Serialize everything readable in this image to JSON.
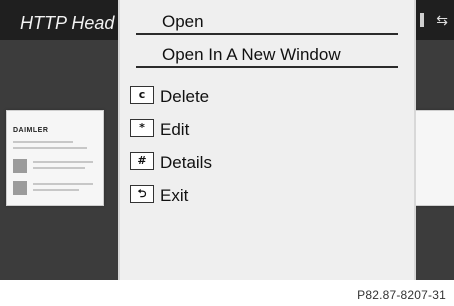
{
  "window": {
    "title": "HTTP Head",
    "right_indicator_icon": "arrow-left-right-icon"
  },
  "menu": {
    "items": [
      {
        "label": "Open"
      },
      {
        "label": "Open In A New Window"
      },
      {
        "label": "Delete",
        "key": "c",
        "icon": "c-key-icon"
      },
      {
        "label": "Edit",
        "key": "*",
        "icon": "star-key-icon"
      },
      {
        "label": "Details",
        "key": "#",
        "icon": "hash-key-icon"
      },
      {
        "label": "Exit",
        "key": "⮌",
        "icon": "return-key-icon"
      }
    ]
  },
  "preview": {
    "brand_text": "DAIMLER"
  },
  "caption": "P82.87-8207-31"
}
